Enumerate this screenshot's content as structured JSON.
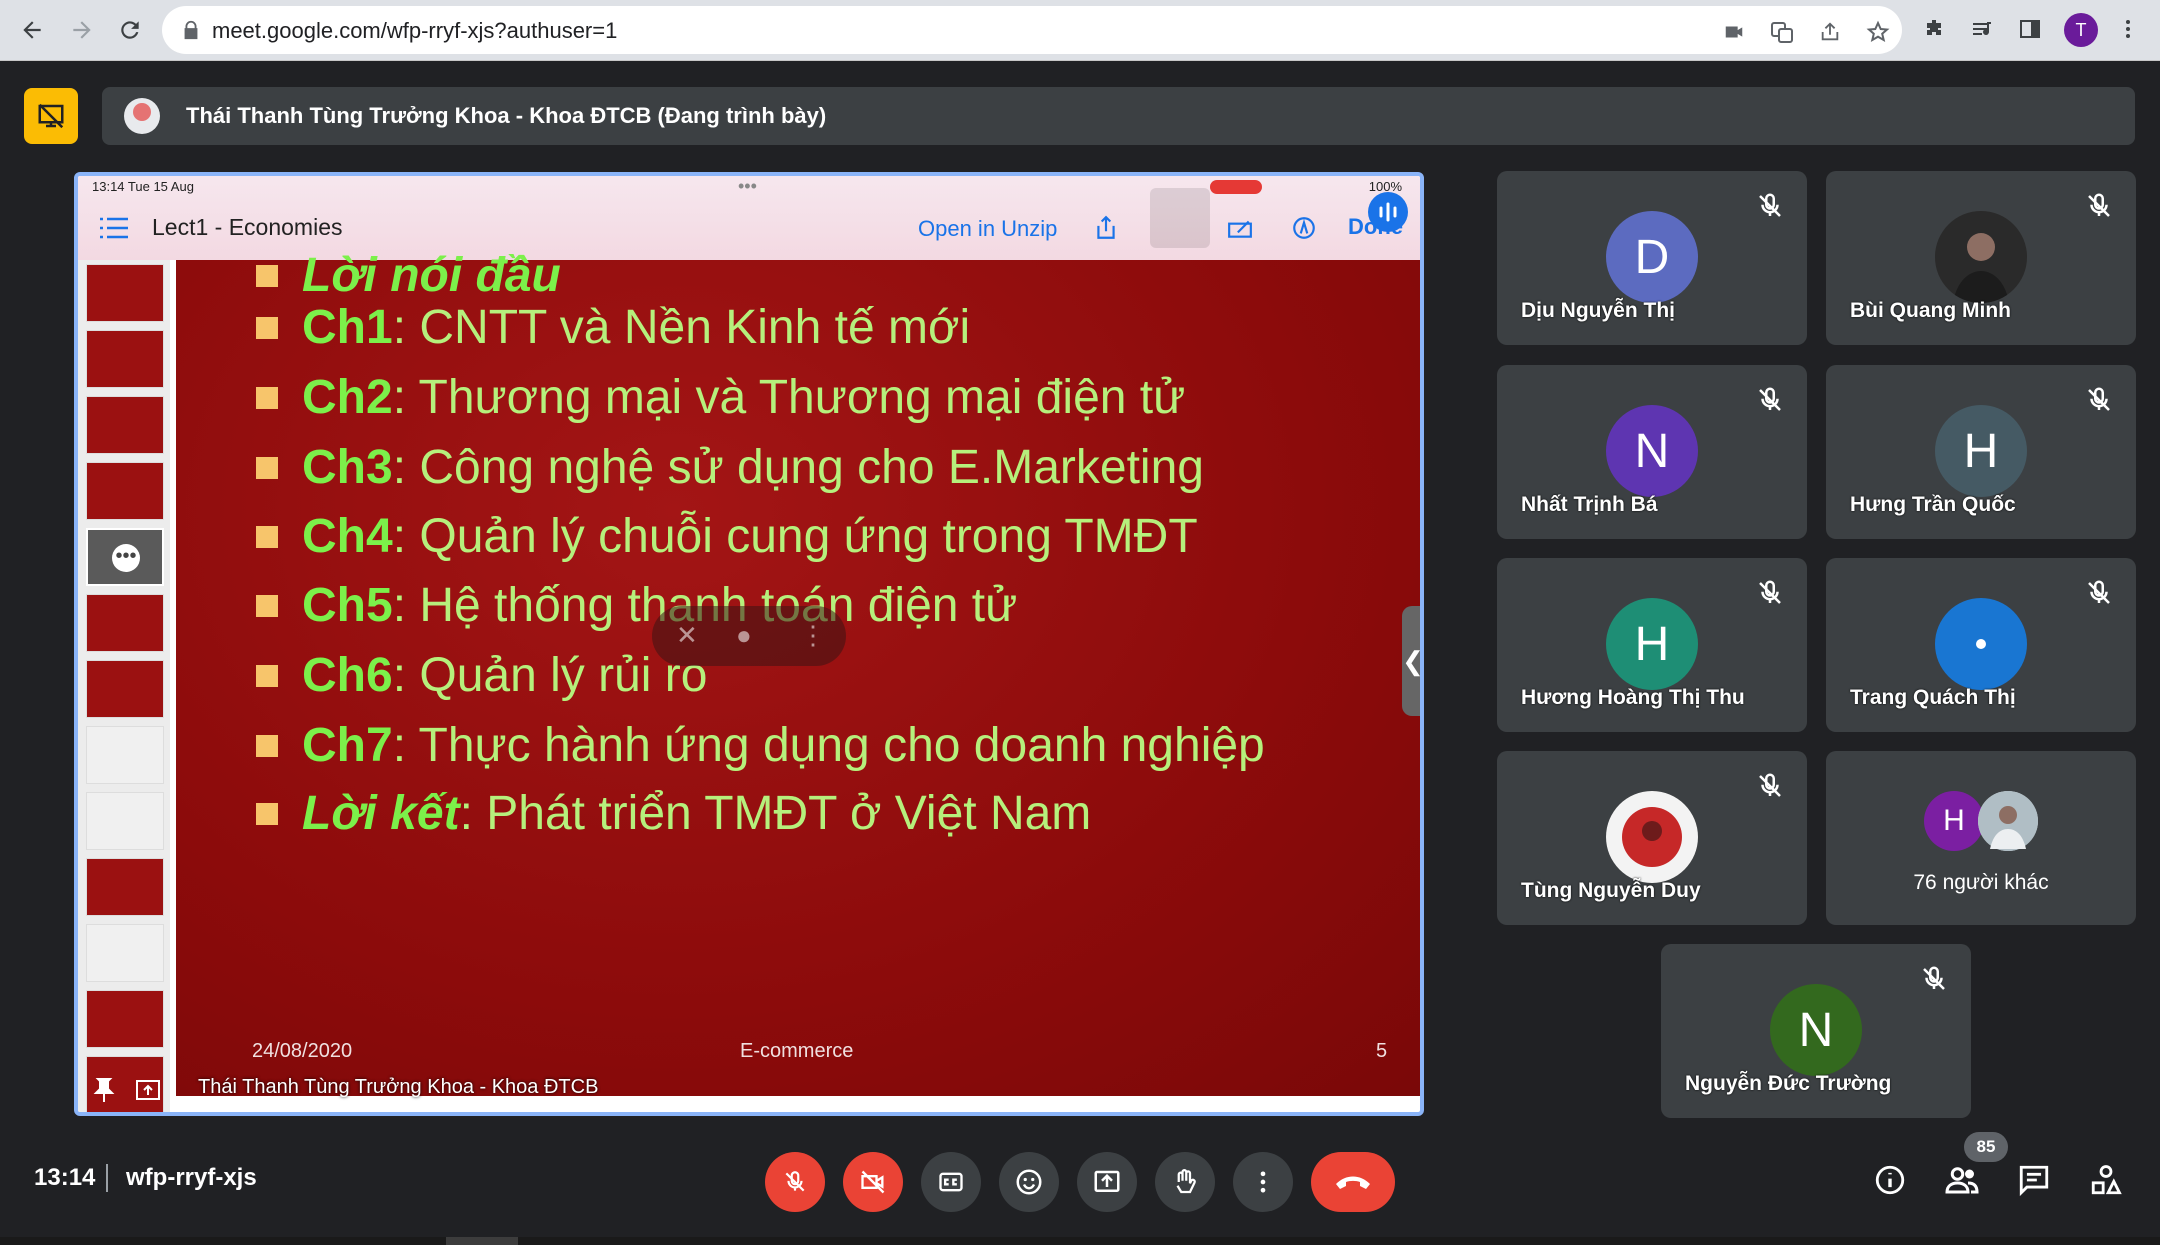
{
  "browser": {
    "url": "meet.google.com/wfp-rryf-xjs?authuser=1",
    "profile_initial": "T"
  },
  "presenter_bar": {
    "label": "Thái Thanh Tùng Trưởng Khoa - Khoa ĐTCB (Đang trình bày)"
  },
  "presentation": {
    "status_time": "13:14   Tue 15 Aug",
    "status_battery": "100%",
    "doc_title": "Lect1 - Economies",
    "open_in": "Open in Unzip",
    "done_label": "Done",
    "bullets": [
      {
        "head": "Lời nói đầu",
        "text": "",
        "style": "intro"
      },
      {
        "head": "Ch1",
        "text": " : CNTT và Nền Kinh tế mới",
        "style": "ch"
      },
      {
        "head": "Ch2",
        "text": " : Thương mại và Thương mại điện tử",
        "style": "ch"
      },
      {
        "head": "Ch3",
        "text": " : Công nghệ sử dụng cho E.Marketing",
        "style": "ch"
      },
      {
        "head": "Ch4",
        "text": " : Quản lý chuỗi cung ứng trong TMĐT",
        "style": "ch"
      },
      {
        "head": "Ch5",
        "text": " : Hệ thống thanh toán điện tử",
        "style": "ch"
      },
      {
        "head": "Ch6",
        "text": " : Quản lý rủi ro",
        "style": "ch"
      },
      {
        "head": "Ch7",
        "text": " : Thực hành ứng dụng cho doanh nghiệp",
        "style": "ch"
      },
      {
        "head": "Lời kết",
        "text": ": Phát triển TMĐT ở Việt Nam",
        "style": "intro"
      }
    ],
    "footer_date": "24/08/2020",
    "footer_center": "E-commerce",
    "footer_page": "5",
    "presenter_name": "Thái Thanh Tùng Trưởng Khoa - Khoa ĐTCB"
  },
  "participants": [
    {
      "name": "Dịu Nguyễn Thị",
      "initial": "D",
      "color": "#5c6bc0"
    },
    {
      "name": "Bùi Quang Minh",
      "initial": "",
      "color": "#2d2d2d"
    },
    {
      "name": "Nhất Trịnh Bá",
      "initial": "N",
      "color": "#5e35b1"
    },
    {
      "name": "Hưng Trần Quốc",
      "initial": "H",
      "color": "#455a64"
    },
    {
      "name": "Hương Hoàng Thị Thu",
      "initial": "H",
      "color": "#1e8e75"
    },
    {
      "name": "Trang Quách Thị",
      "initial": "",
      "color": "#1976d2"
    },
    {
      "name": "Tùng Nguyễn Duy",
      "initial": "",
      "color": "#b71c1c"
    },
    {
      "name": "Nguyễn Đức Trường",
      "initial": "N",
      "color": "#33691e"
    }
  ],
  "others": {
    "initial": "H",
    "label": "76 người khác"
  },
  "bottom_bar": {
    "time": "13:14",
    "meeting_code": "wfp-rryf-xjs",
    "people_count": "85"
  },
  "icons": {
    "mic": "mic-off-icon",
    "camera": "camera-off-icon",
    "captions": "captions-icon",
    "emoji": "emoji-icon",
    "present": "present-icon",
    "hand": "raise-hand-icon",
    "more": "more-vert-icon",
    "end": "end-call-icon",
    "info": "info-icon",
    "people": "people-icon",
    "chat": "chat-icon",
    "activities": "activities-icon"
  }
}
